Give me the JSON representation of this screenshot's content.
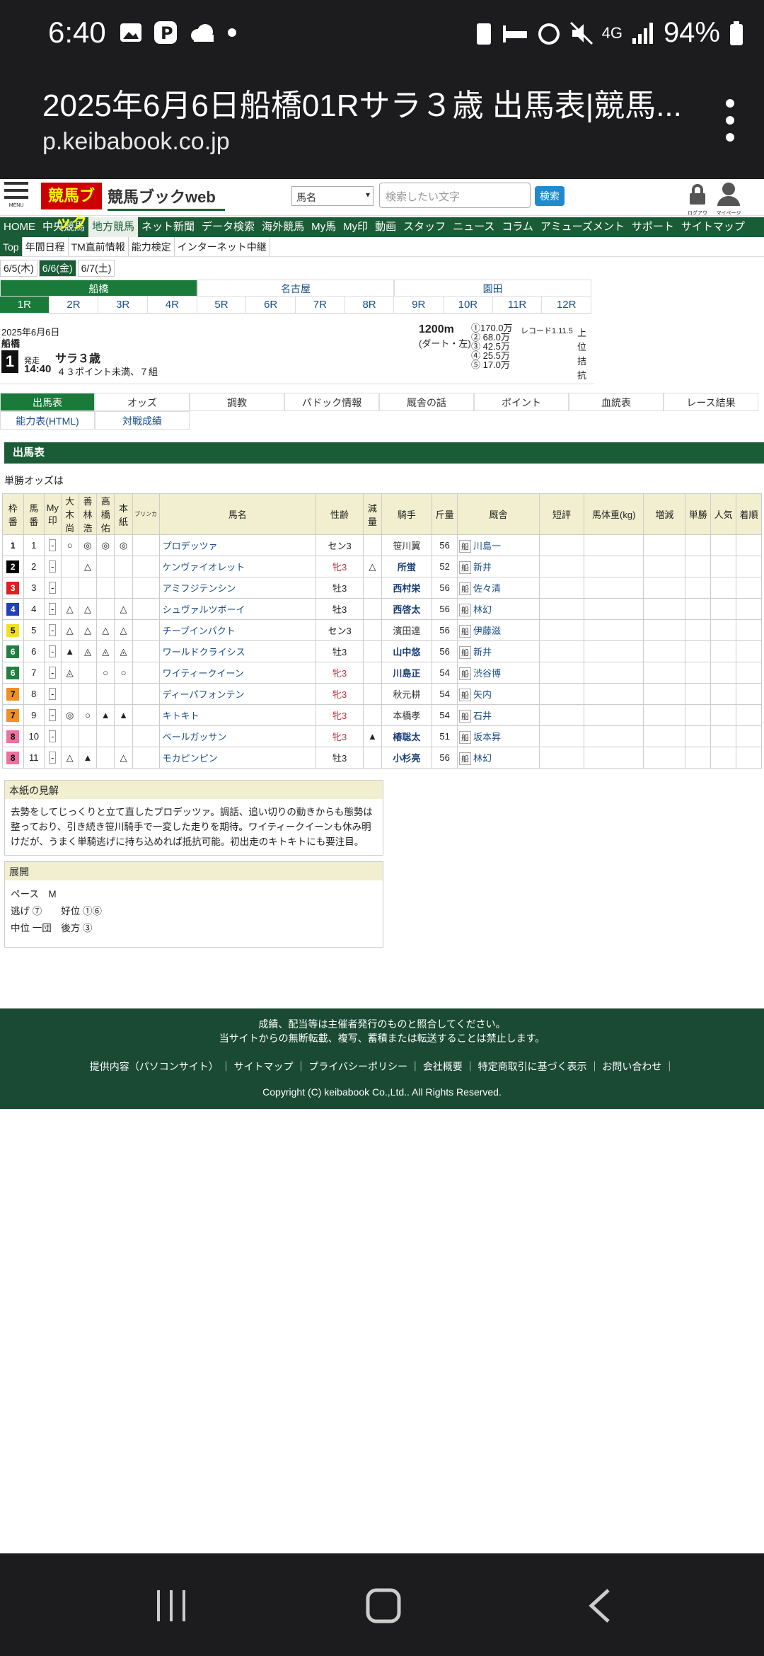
{
  "status_bar": {
    "time": "6:40",
    "battery": "94%",
    "network": "4G"
  },
  "browser": {
    "title": "2025年6月6日船橋01Rサラ３歳 出馬表|競馬...",
    "url": "p.keibabook.co.jp"
  },
  "header": {
    "logo_text": "競馬ブック",
    "brand": "競馬ブックweb",
    "search_type": "馬名",
    "search_placeholder": "検索したい文字",
    "search_button": "検索",
    "logout_label": "ログアウト",
    "mypage_label": "マイページ",
    "menu_label": "MENU"
  },
  "main_nav": [
    "HOME",
    "中央競馬",
    "地方競馬",
    "ネット新聞",
    "データ検索",
    "海外競馬",
    "My馬",
    "My印",
    "動画",
    "スタッフ",
    "ニュース",
    "コラム",
    "アミューズメント",
    "サポート",
    "サイトマップ"
  ],
  "sub_nav": [
    "Top",
    "年間日程",
    "TM直前情報",
    "能力検定",
    "インターネット中継"
  ],
  "dates": [
    "6/5(木)",
    "6/6(金)",
    "6/7(土)"
  ],
  "venues": [
    "船橋",
    "名古屋",
    "園田"
  ],
  "races": [
    "1R",
    "2R",
    "3R",
    "4R",
    "5R",
    "6R",
    "7R",
    "8R",
    "9R",
    "10R",
    "11R",
    "12R"
  ],
  "race_info": {
    "date": "2025年6月6日",
    "venue": "船橋",
    "number": "1",
    "start_label": "発走",
    "start_time": "14:40",
    "race_name": "サラ３歳",
    "condition": "４３ポイント未満、７組",
    "distance": "1200m",
    "course": "(ダート・左)",
    "prizes": [
      "①170.0万",
      "② 68.0万",
      "③ 42.5万",
      "④ 25.5万",
      "⑤ 17.0万"
    ],
    "record": "レコード1.11.5",
    "side_text": [
      "上",
      "位",
      "拮",
      "抗"
    ]
  },
  "tabs": [
    "出馬表",
    "オッズ",
    "調教",
    "パドック情報",
    "厩舎の話",
    "ポイント",
    "血統表",
    "レース結果"
  ],
  "tabs2": [
    "能力表(HTML)",
    "対戦成績"
  ],
  "section_title": "出馬表",
  "odds_label": "単勝オッズは",
  "table": {
    "headers": [
      "枠番",
      "馬番",
      "My印",
      "大木尚",
      "善林浩",
      "高橋佑",
      "本紙",
      "ブリンカ",
      "馬名",
      "性齢",
      "減量",
      "騎手",
      "斤量",
      "厩舎",
      "短評",
      "馬体重(kg)",
      "増減",
      "単勝",
      "人気",
      "着順"
    ],
    "rows": [
      {
        "waku": "1",
        "umaban": "1",
        "my": "-",
        "m1": "○",
        "m2": "◎",
        "m3": "◎",
        "m4": "◎",
        "name": "プロデッツァ",
        "sex": "セン3",
        "gen": "",
        "jockey": "笹川翼",
        "jb": false,
        "kin": "56",
        "stable": "川島一"
      },
      {
        "waku": "2",
        "umaban": "2",
        "my": "-",
        "m1": "",
        "m2": "△",
        "m3": "",
        "m4": "",
        "name": "ケンヴァイオレット",
        "sex": "牝3",
        "gen": "△",
        "jockey": "所蛍",
        "jb": true,
        "kin": "52",
        "stable": "新井"
      },
      {
        "waku": "3",
        "umaban": "3",
        "my": "-",
        "m1": "",
        "m2": "",
        "m3": "",
        "m4": "",
        "name": "アミフジテンシン",
        "sex": "牡3",
        "gen": "",
        "jockey": "西村栄",
        "jb": true,
        "kin": "56",
        "stable": "佐々清"
      },
      {
        "waku": "4",
        "umaban": "4",
        "my": "-",
        "m1": "△",
        "m2": "△",
        "m3": "",
        "m4": "△",
        "name": "シュヴァルツボーイ",
        "sex": "牡3",
        "gen": "",
        "jockey": "西啓太",
        "jb": true,
        "kin": "56",
        "stable": "林幻"
      },
      {
        "waku": "5",
        "umaban": "5",
        "my": "-",
        "m1": "△",
        "m2": "△",
        "m3": "△",
        "m4": "△",
        "name": "チープインパクト",
        "sex": "セン3",
        "gen": "",
        "jockey": "濱田達",
        "jb": false,
        "kin": "56",
        "stable": "伊藤滋"
      },
      {
        "waku": "6",
        "umaban": "6",
        "my": "-",
        "m1": "▲",
        "m2": "◬",
        "m3": "◬",
        "m4": "◬",
        "name": "ワールドクライシス",
        "sex": "牡3",
        "gen": "",
        "jockey": "山中悠",
        "jb": true,
        "kin": "56",
        "stable": "新井"
      },
      {
        "waku": "6",
        "umaban": "7",
        "my": "-",
        "m1": "◬",
        "m2": "",
        "m3": "○",
        "m4": "○",
        "name": "ワイティークイーン",
        "sex": "牝3",
        "gen": "",
        "jockey": "川島正",
        "jb": true,
        "kin": "54",
        "stable": "渋谷博"
      },
      {
        "waku": "7",
        "umaban": "8",
        "my": "-",
        "m1": "",
        "m2": "",
        "m3": "",
        "m4": "",
        "name": "ディーパフォンテン",
        "sex": "牝3",
        "gen": "",
        "jockey": "秋元耕",
        "jb": false,
        "kin": "54",
        "stable": "矢内"
      },
      {
        "waku": "7",
        "umaban": "9",
        "my": "-",
        "m1": "◎",
        "m2": "○",
        "m3": "▲",
        "m4": "▲",
        "name": "キトキト",
        "sex": "牝3",
        "gen": "",
        "jockey": "本橋孝",
        "jb": false,
        "kin": "54",
        "stable": "石井"
      },
      {
        "waku": "8",
        "umaban": "10",
        "my": "-",
        "m1": "",
        "m2": "",
        "m3": "",
        "m4": "",
        "name": "ベールガッサン",
        "sex": "牝3",
        "gen": "▲",
        "jockey": "椿聡太",
        "jb": true,
        "kin": "51",
        "stable": "坂本昇"
      },
      {
        "waku": "8",
        "umaban": "11",
        "my": "-",
        "m1": "△",
        "m2": "▲",
        "m3": "",
        "m4": "△",
        "name": "モカピンピン",
        "sex": "牡3",
        "gen": "",
        "jockey": "小杉亮",
        "jb": true,
        "kin": "56",
        "stable": "林幻"
      }
    ],
    "stable_prefix": "船"
  },
  "opinion": {
    "title": "本紙の見解",
    "text": "去勢をしてじっくりと立て直したプロデッツァ。調話、追い切りの動きからも態勢は整っており、引き続き笹川騎手で一変した走りを期待。ワイティークイーンも休み明けだが、うまく単騎逃げに持ち込めれば抵抗可能。初出走のキトキトにも要注目。"
  },
  "tenkai": {
    "title": "展開",
    "pace": "ペース　M",
    "nige": "逃げ ⑦",
    "koui": "好位 ①⑥",
    "chui": "中位 一団",
    "koho": "後方 ③"
  },
  "footer": {
    "line1": "成績、配当等は主催者発行のものと照合してください。",
    "line2": "当サイトからの無断転載、複写、蓄積または転送することは禁止します。",
    "links": [
      "提供内容（パソコンサイト）",
      "サイトマップ",
      "プライバシーポリシー",
      "会社概要",
      "特定商取引に基づく表示",
      "お問い合わせ"
    ],
    "copyright": "Copyright (C) keibabook Co.,Ltd.. All Rights Reserved."
  },
  "colors": {
    "brand_green": "#1a5c36",
    "accent_blue": "#1f8ad0",
    "logo_red": "#cc0000"
  },
  "waku_colors": {
    "1": [
      "#ffffff",
      "#000000"
    ],
    "2": [
      "#000000",
      "#ffffff"
    ],
    "3": [
      "#e02020",
      "#ffffff"
    ],
    "4": [
      "#2040c0",
      "#ffffff"
    ],
    "5": [
      "#f2e020",
      "#000000"
    ],
    "6": [
      "#208040",
      "#ffffff"
    ],
    "7": [
      "#f09020",
      "#000000"
    ],
    "8": [
      "#f070a0",
      "#000000"
    ]
  }
}
